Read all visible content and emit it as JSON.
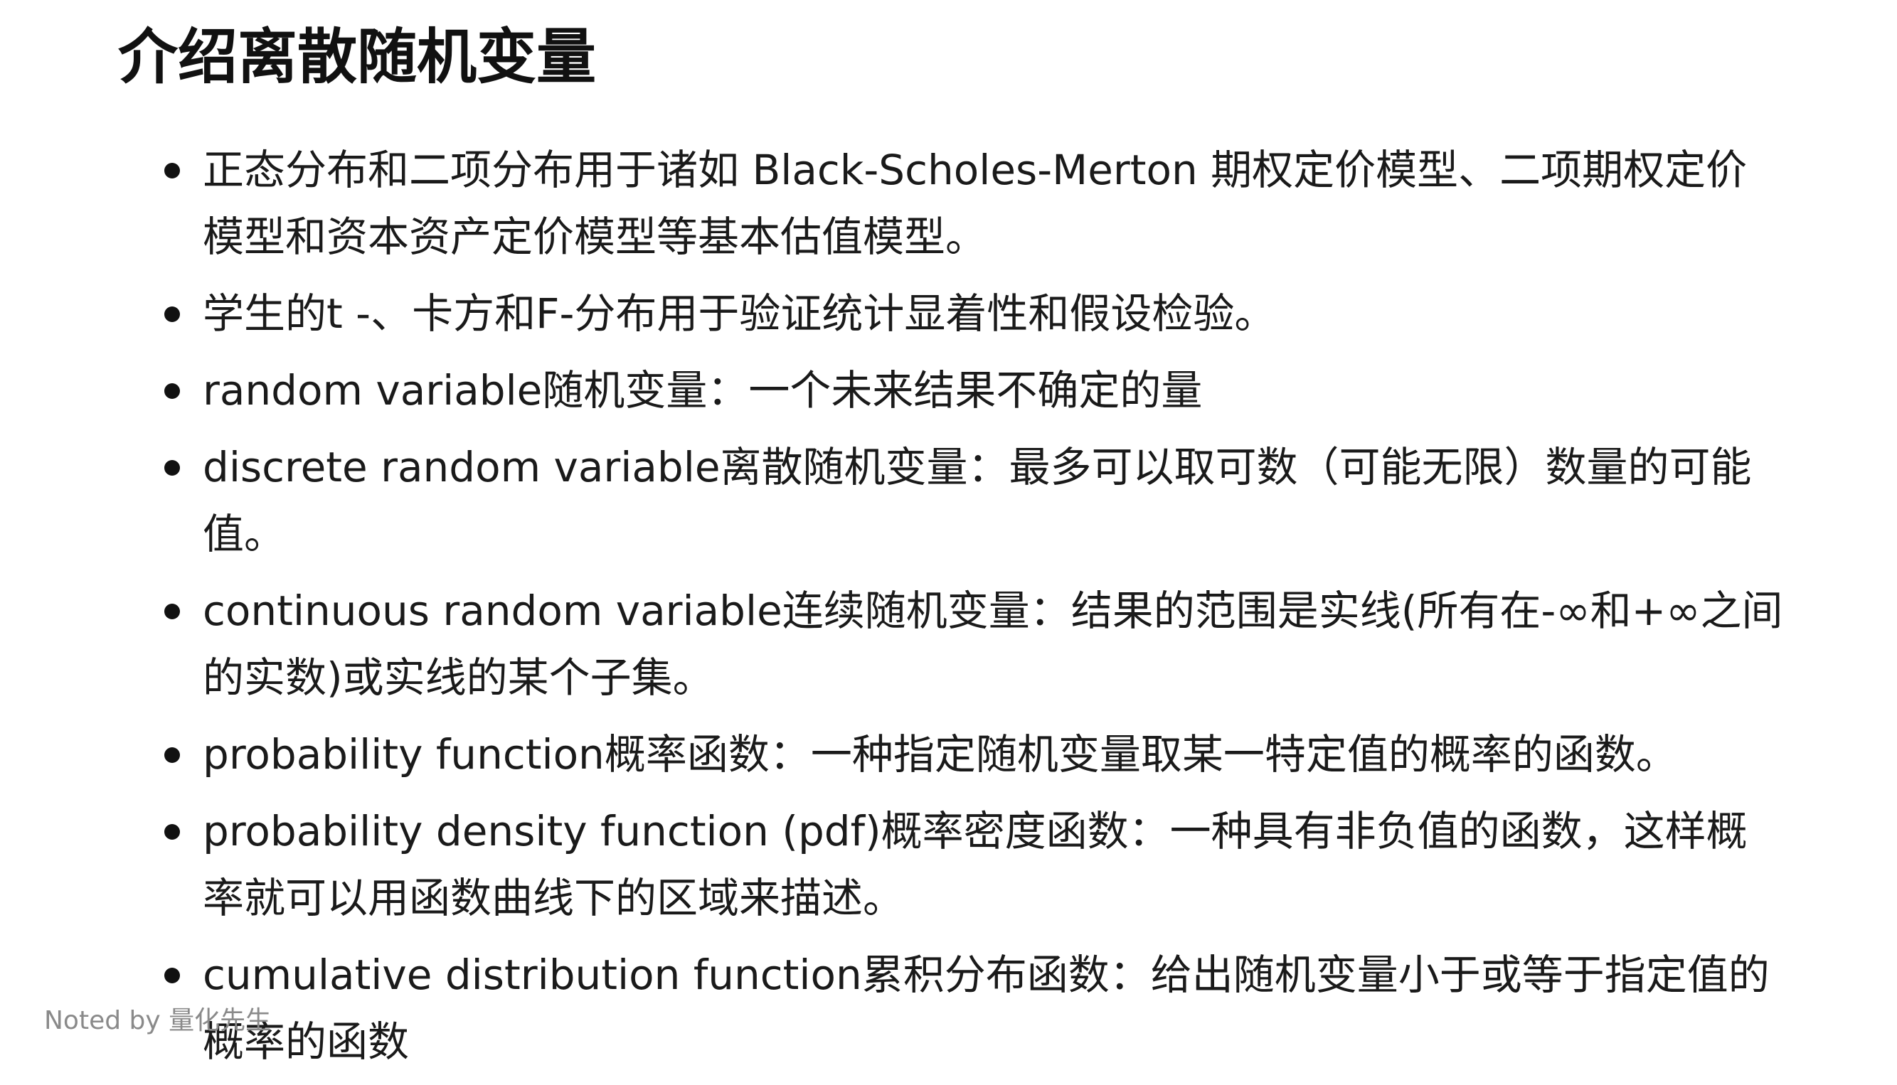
{
  "title": "介绍离散随机变量",
  "bullets": [
    "正态分布和二项分布用于诸如 Black-Scholes-Merton 期权定价模型、二项期权定价模型和资本资产定价模型等基本估值模型。",
    "学生的t -、卡方和F-分布用于验证统计显着性和假设检验。",
    "random variable随机变量：一个未来结果不确定的量",
    "discrete random variable离散随机变量：最多可以取可数（可能无限）数量的可能值。",
    "continuous random variable连续随机变量：结果的范围是实线(所有在-∞和+∞之间的实数)或实线的某个子集。",
    "probability function概率函数：一种指定随机变量取某一特定值的概率的函数。",
    "probability density function (pdf)概率密度函数：一种具有非负值的函数，这样概率就可以用函数曲线下的区域来描述。",
    "cumulative distribution function累积分布函数：给出随机变量小于或等于指定值的概率的函数"
  ],
  "watermark": "Noted by 量化先生"
}
